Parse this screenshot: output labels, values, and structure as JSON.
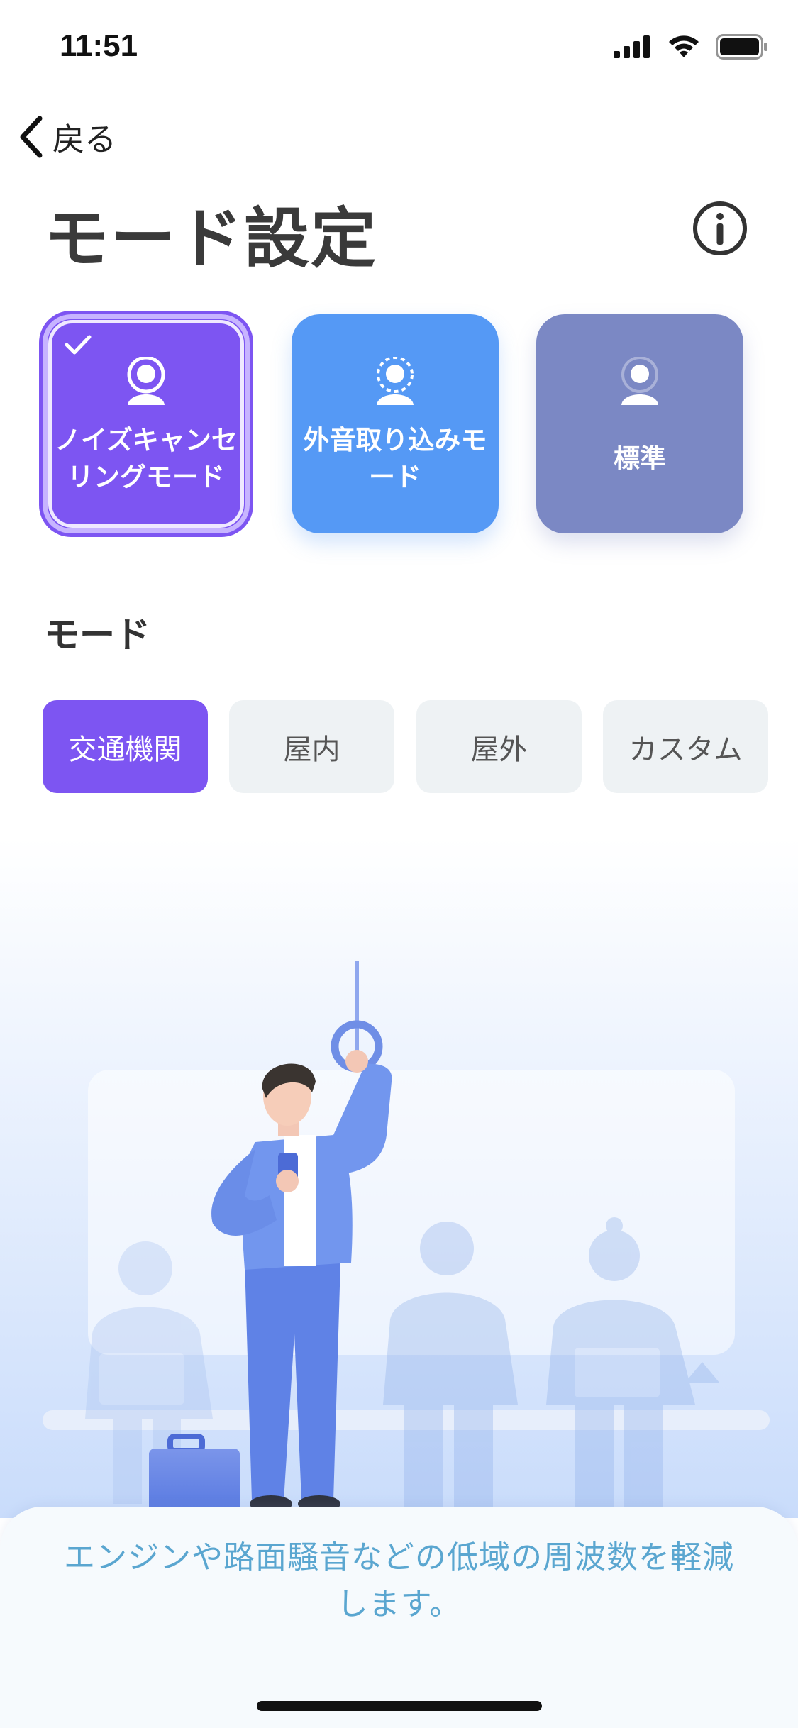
{
  "status_bar": {
    "time": "11:51"
  },
  "nav": {
    "back_label": "戻る"
  },
  "page_title": "モード設定",
  "mode_cards": [
    {
      "label": "ノイズキャンセリングモード",
      "selected": true,
      "color": "#7d55f2"
    },
    {
      "label": "外音取り込みモード",
      "selected": false,
      "color": "#5599f5"
    },
    {
      "label": "標準",
      "selected": false,
      "color": "#7b88c4"
    }
  ],
  "section_label": "モード",
  "tabs": [
    {
      "label": "交通機関",
      "active": true
    },
    {
      "label": "屋内",
      "active": false
    },
    {
      "label": "屋外",
      "active": false
    },
    {
      "label": "カスタム",
      "active": false
    }
  ],
  "description": "エンジンや路面騒音などの低域の周波数を軽減します。",
  "colors": {
    "accent": "#7d55f2",
    "description_text": "#5aa6d0"
  }
}
